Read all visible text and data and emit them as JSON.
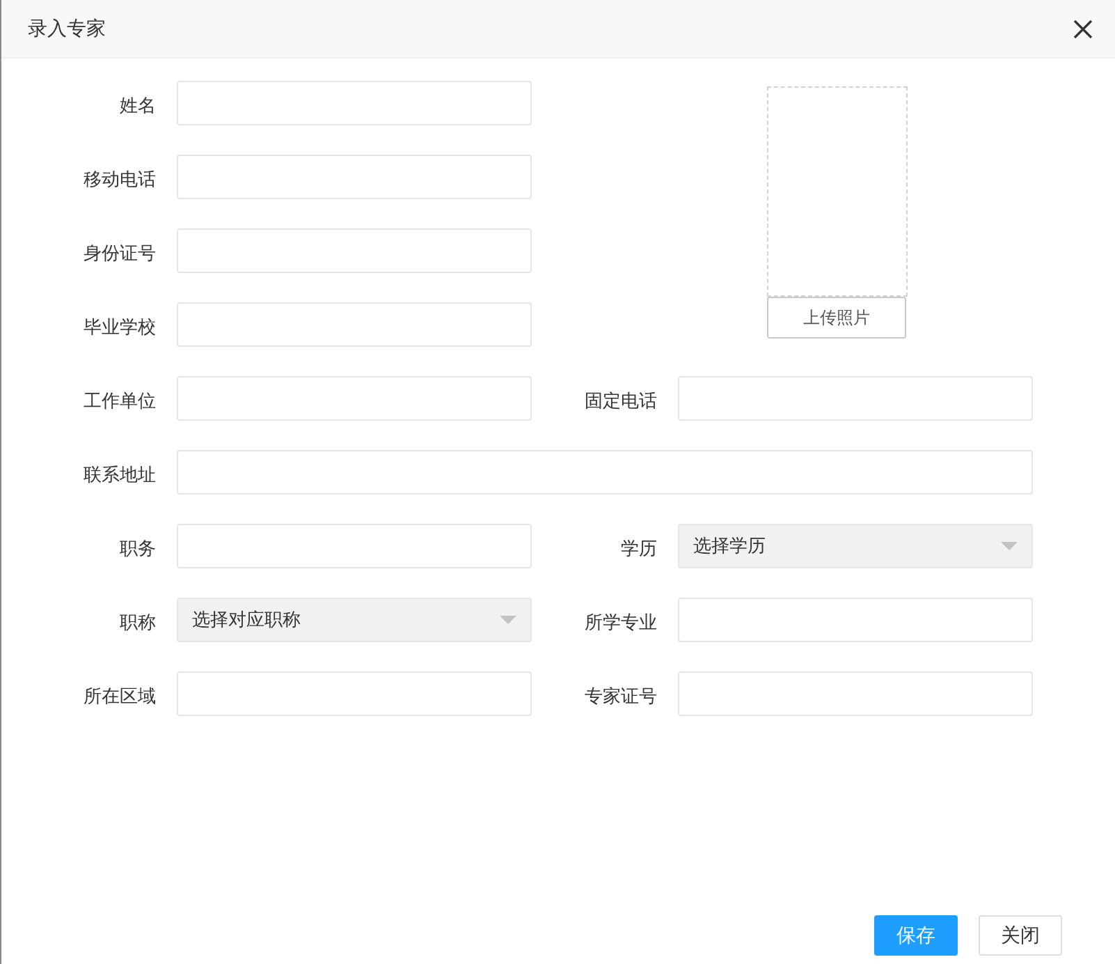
{
  "window": {
    "title": "录入专家"
  },
  "rows": [
    {
      "fields": [
        {
          "label": "姓名",
          "kind": "text"
        }
      ]
    },
    {
      "fields": [
        {
          "label": "移动电话",
          "kind": "text"
        }
      ]
    },
    {
      "fields": [
        {
          "label": "身份证号",
          "kind": "text"
        }
      ]
    },
    {
      "fields": [
        {
          "label": "毕业学校",
          "kind": "text"
        }
      ]
    },
    {
      "fields": [
        {
          "label": "工作单位",
          "kind": "text"
        },
        {
          "label": "固定电话",
          "kind": "text"
        }
      ]
    },
    {
      "fields": [
        {
          "label": "联系地址",
          "kind": "long-text"
        }
      ]
    },
    {
      "fields": [
        {
          "label": "职务",
          "kind": "text"
        },
        {
          "label": "学历",
          "kind": "select",
          "value": "选择学历"
        }
      ]
    },
    {
      "fields": [
        {
          "label": "职称",
          "kind": "select",
          "value": "选择对应职称"
        },
        {
          "label": "所学专业",
          "kind": "text"
        }
      ]
    },
    {
      "fields": [
        {
          "label": "所在区域",
          "kind": "text"
        },
        {
          "label": "专家证号",
          "kind": "text"
        }
      ]
    }
  ],
  "photo": {
    "button": "上传照片"
  },
  "buttons": [
    {
      "label": "保存",
      "kind": "primary"
    },
    {
      "label": "关闭",
      "kind": "default"
    }
  ]
}
